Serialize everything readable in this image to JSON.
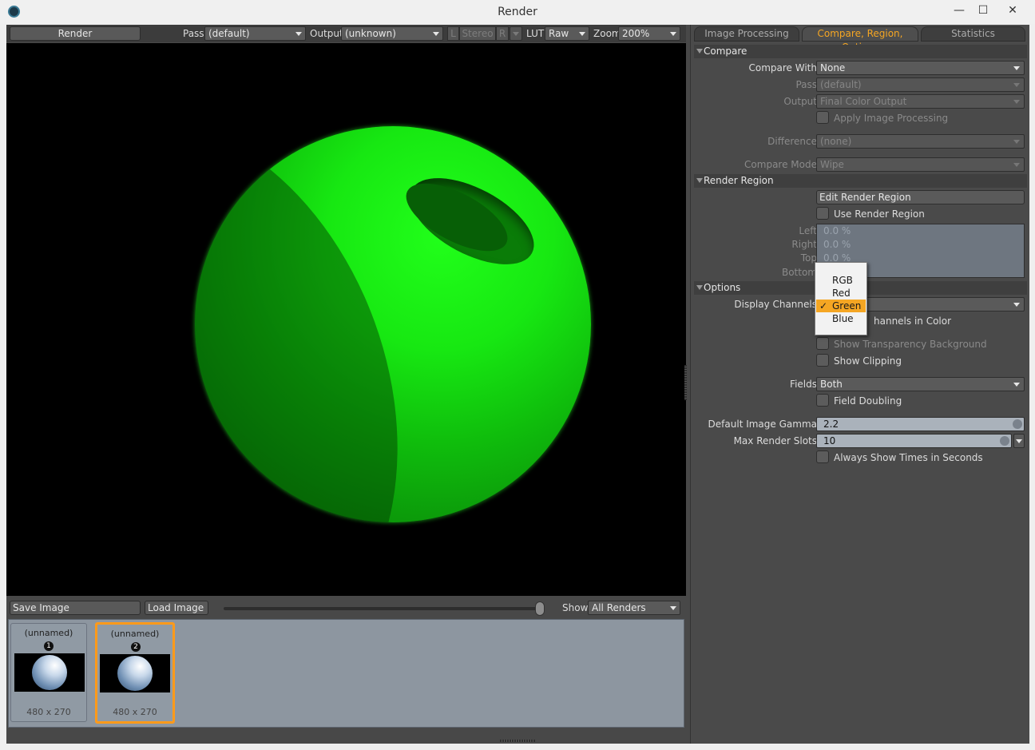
{
  "window": {
    "title": "Render",
    "controls": {
      "minimize": "—",
      "maximize": "☐",
      "close": "✕"
    }
  },
  "toolbar": {
    "render_label": "Render",
    "pass_label": "Pass",
    "pass_value": "(default)",
    "output_label": "Output",
    "output_value": "(unknown)",
    "l_label": "L",
    "stereo_label": "Stereo",
    "r_label": "R",
    "lut_label": "LUT",
    "lut_value": "Raw",
    "zoom_label": "Zoom",
    "zoom_value": "200%"
  },
  "viewport": {
    "channel_shown": "Green",
    "accent": "#17e812"
  },
  "bottom": {
    "save_label": "Save Image",
    "load_label": "Load Image",
    "show_label": "Show",
    "show_value": "All Renders"
  },
  "thumbnails": [
    {
      "name": "(unnamed)",
      "number": "1",
      "size": "480 x 270",
      "selected": false
    },
    {
      "name": "(unnamed)",
      "number": "2",
      "size": "480 x 270",
      "selected": true
    }
  ],
  "panel": {
    "tabs": [
      "Image Processing",
      "Compare, Region, Options",
      "Statistics"
    ],
    "active_tab_color": "#f5a623",
    "compare": {
      "header": "Compare",
      "compare_with_label": "Compare With",
      "compare_with_value": "None",
      "pass_label": "Pass",
      "pass_value": "(default)",
      "output_label": "Output",
      "output_value": "Final Color Output",
      "apply_label": "Apply Image Processing",
      "difference_label": "Difference",
      "difference_value": "(none)",
      "mode_label": "Compare Mode",
      "mode_value": "Wipe"
    },
    "region": {
      "header": "Render Region",
      "edit_label": "Edit Render Region",
      "use_label": "Use Render Region",
      "left_label": "Left",
      "left_value": "0.0 %",
      "right_label": "Right",
      "right_value": "0.0 %",
      "top_label": "Top",
      "top_value": "0.0 %",
      "bottom_label": "Bottom"
    },
    "options": {
      "header": "Options",
      "display_channels_label": "Display Channels",
      "channels_color_label": "hannels in Color",
      "transparency_label": "Show Transparency Background",
      "clipping_label": "Show Clipping",
      "fields_label": "Fields",
      "fields_value": "Both",
      "field_doubling_label": "Field Doubling",
      "gamma_label": "Default Image Gamma",
      "gamma_value": "2.2",
      "slots_label": "Max Render Slots",
      "slots_value": "10",
      "times_label": "Always Show Times in Seconds"
    }
  },
  "channel_menu": {
    "options": [
      "RGB",
      "Red",
      "Green",
      "Blue"
    ],
    "selected": "Green",
    "check_glyph": "✓"
  }
}
